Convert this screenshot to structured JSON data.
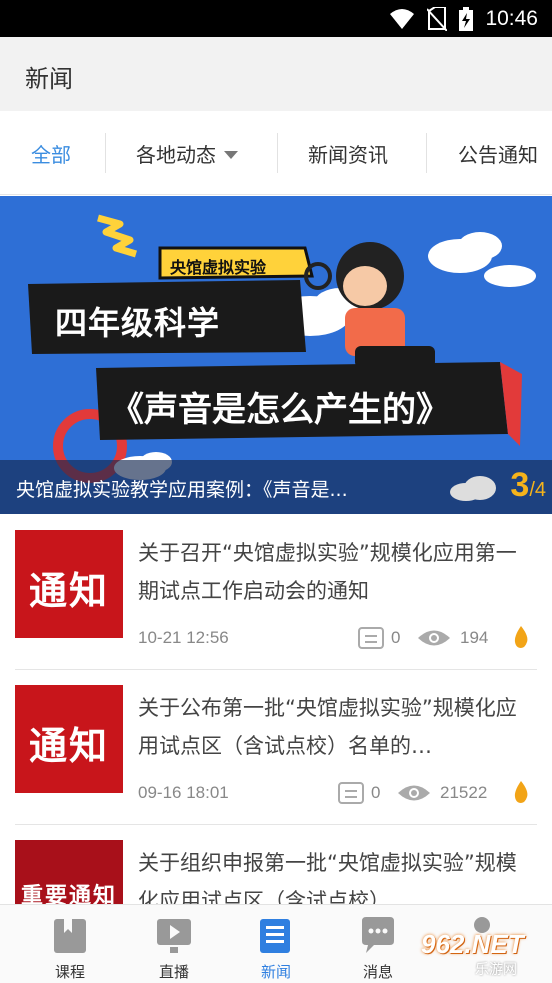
{
  "status_bar": {
    "time": "10:46",
    "icons": [
      "wifi-icon",
      "no-sim-icon",
      "battery-charging-icon"
    ]
  },
  "app_bar": {
    "title": "新闻"
  },
  "tabs": [
    {
      "label": "全部",
      "active": true
    },
    {
      "label": "各地动态",
      "dropdown": true
    },
    {
      "label": "新闻资讯"
    },
    {
      "label": "公告通知"
    }
  ],
  "banner": {
    "tag": "央馆虚拟实验",
    "heading": "四年级科学",
    "subheading": "《声音是怎么产生的》",
    "caption": "央馆虚拟实验教学应用案例：《声音是...",
    "page_current": "3",
    "page_total": "/4"
  },
  "news": [
    {
      "thumb_text": "通知",
      "title": "关于召开“央馆虚拟实验”规模化应用第一期试点工作启动会的通知",
      "date": "10-21 12:56",
      "comments": "0",
      "views": "194"
    },
    {
      "thumb_text": "通知",
      "title": "关于公布第一批“央馆虚拟实验”规模化应用试点区（含试点校）名单的…",
      "date": "09-16 18:01",
      "comments": "0",
      "views": "21522"
    },
    {
      "thumb_text": "重要通知",
      "title": "关于组织申报第一批“央馆虚拟实验”规模化应用试点区（含试点校）"
    }
  ],
  "bottom_nav": [
    {
      "label": "课程",
      "icon": "book-icon"
    },
    {
      "label": "直播",
      "icon": "live-play-icon"
    },
    {
      "label": "新闻",
      "icon": "news-icon",
      "active": true
    },
    {
      "label": "消息",
      "icon": "message-icon"
    },
    {
      "label": "",
      "icon": "profile-icon"
    }
  ],
  "watermark": {
    "text": "962.NET",
    "sub": "乐游网"
  },
  "colors": {
    "accent": "#3b8de0",
    "banner_bg": "#2e6fd6",
    "thumb_red": "#c8151b",
    "pager": "#f5b31b"
  }
}
